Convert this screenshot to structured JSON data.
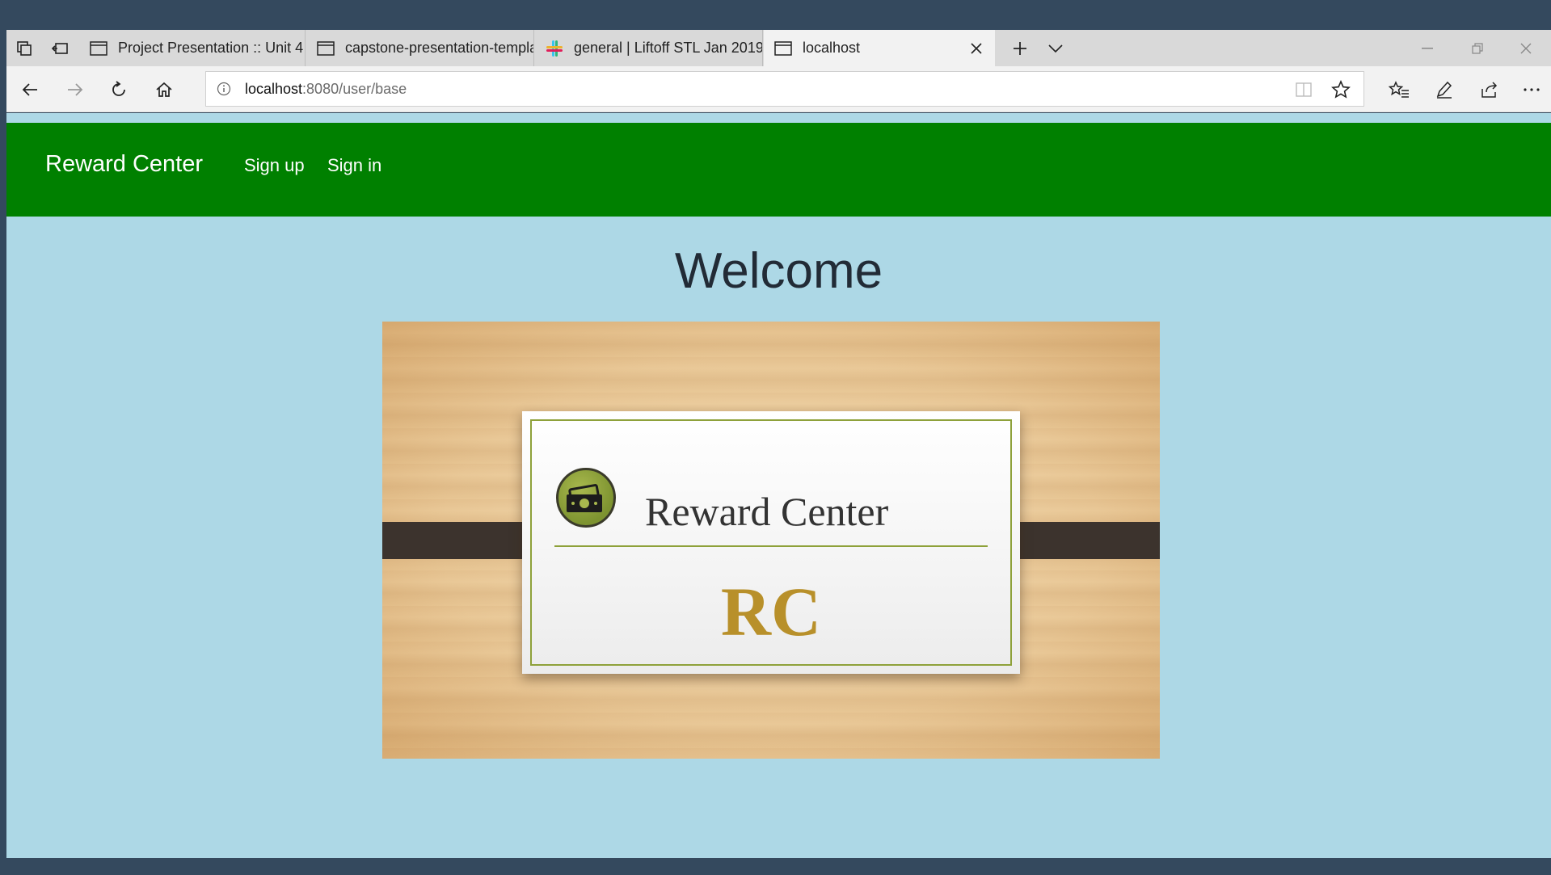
{
  "browser": {
    "tabs": [
      {
        "label": "Project Presentation :: Unit 4",
        "icon": "page-icon"
      },
      {
        "label": "capstone-presentation-template",
        "icon": "page-icon"
      },
      {
        "label": "general | Liftoff STL Jan 2019",
        "icon": "slack-icon"
      },
      {
        "label": "localhost",
        "icon": "page-icon",
        "active": true
      }
    ],
    "address": {
      "host": "localhost",
      "path": ":8080/user/base"
    }
  },
  "site": {
    "brand": "Reward Center",
    "nav": [
      "Sign up",
      "Sign in"
    ],
    "nav_color": "#008000",
    "background": "#add8e6"
  },
  "main": {
    "heading": "Welcome",
    "banner": {
      "title": "Reward Center",
      "initials": "RC",
      "accent": "#b8902a"
    }
  }
}
